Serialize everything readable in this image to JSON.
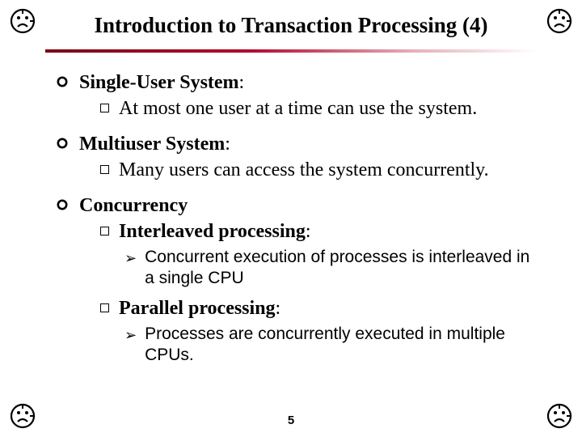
{
  "title": "Introduction to Transaction Processing (4)",
  "page_number": "5",
  "corner_icon": "clock-sad-icon",
  "items": [
    {
      "head_bold": "Single-User System",
      "head_tail": ":",
      "subs": [
        {
          "text": "At most one user at a time can use the system."
        }
      ]
    },
    {
      "head_bold": "Multiuser System",
      "head_tail": ":",
      "subs": [
        {
          "text": "Many users can access the system concurrently."
        }
      ]
    },
    {
      "head_bold": "Concurrency",
      "head_tail": "",
      "subs": [
        {
          "rich_bold": "Interleaved processing",
          "rich_tail": ":",
          "arrows": [
            "Concurrent execution of processes is interleaved in a single CPU"
          ]
        },
        {
          "rich_bold": "Parallel processing",
          "rich_tail": ":",
          "arrows": [
            "Processes are concurrently executed in multiple CPUs."
          ]
        }
      ]
    }
  ]
}
